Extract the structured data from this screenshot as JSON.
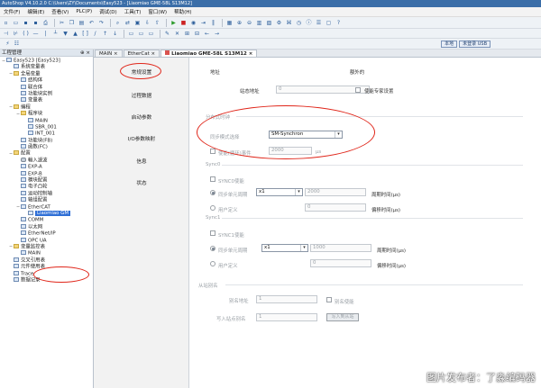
{
  "window": {
    "title": "AutoShop V4.10.2.0  C:\\Users\\ZY\\Documents\\Easy523 - [Liaomiao GME-58L S13M12]"
  },
  "menu": [
    "文件(F)",
    "编辑(E)",
    "查看(V)",
    "PLC(P)",
    "调试(D)",
    "工具(T)",
    "窗口(W)",
    "帮助(H)"
  ],
  "toolbar": {
    "local_label": "本地",
    "plc_status": "未登录 USB"
  },
  "left_panel": {
    "title": "工程管理",
    "pin": "⊕ ×",
    "tree": [
      {
        "label": "Easy523 [Easy523]",
        "indent": 0,
        "icon": "project-icon"
      },
      {
        "label": "系统变量表",
        "indent": 1,
        "icon": "table-icon"
      },
      {
        "label": "全局变量",
        "indent": 1,
        "icon": "folder-icon"
      },
      {
        "label": "结构体",
        "indent": 2,
        "icon": "struct-icon"
      },
      {
        "label": "联合体",
        "indent": 2,
        "icon": "union-icon"
      },
      {
        "label": "功能块实例",
        "indent": 2,
        "icon": "fb-icon"
      },
      {
        "label": "变量表",
        "indent": 2,
        "icon": "table-icon"
      },
      {
        "label": "编程",
        "indent": 1,
        "icon": "folder-icon"
      },
      {
        "label": "程序块",
        "indent": 2,
        "icon": "folder-icon"
      },
      {
        "label": "MAIN",
        "indent": 3,
        "icon": "program-icon"
      },
      {
        "label": "SBR_001",
        "indent": 3,
        "icon": "program-icon"
      },
      {
        "label": "INT_001",
        "indent": 3,
        "icon": "program-icon"
      },
      {
        "label": "功能块(FB)",
        "indent": 2,
        "icon": "fb-icon"
      },
      {
        "label": "函数(FC)",
        "indent": 2,
        "icon": "fc-icon"
      },
      {
        "label": "配置",
        "indent": 1,
        "icon": "folder-icon"
      },
      {
        "label": "輸入濾波",
        "indent": 2,
        "icon": "gear-icon"
      },
      {
        "label": "EXP-A",
        "indent": 2,
        "icon": "module-icon"
      },
      {
        "label": "EXP-B",
        "indent": 2,
        "icon": "module-icon"
      },
      {
        "label": "模块配置",
        "indent": 2,
        "icon": "module-icon"
      },
      {
        "label": "电子凸轮",
        "indent": 2,
        "icon": "cam-icon"
      },
      {
        "label": "运动控制轴",
        "indent": 2,
        "icon": "axis-icon"
      },
      {
        "label": "轴组配置",
        "indent": 2,
        "icon": "axis-icon"
      },
      {
        "label": "EtherCAT",
        "indent": 2,
        "icon": "network-icon"
      },
      {
        "label": "Liaomiao GM",
        "indent": 3,
        "icon": "device-icon",
        "selected": true
      },
      {
        "label": "COMM",
        "indent": 2,
        "icon": "comm-icon"
      },
      {
        "label": "以太网",
        "indent": 2,
        "icon": "network-icon"
      },
      {
        "label": "EtherNet/IP",
        "indent": 2,
        "icon": "network-icon"
      },
      {
        "label": "OPC UA",
        "indent": 2,
        "icon": "network-icon"
      },
      {
        "label": "变量监控表",
        "indent": 1,
        "icon": "folder-icon"
      },
      {
        "label": "MAIN",
        "indent": 2,
        "icon": "table-icon"
      },
      {
        "label": "交叉引用表",
        "indent": 1,
        "icon": "table-icon"
      },
      {
        "label": "元件使用表",
        "indent": 1,
        "icon": "table-icon"
      },
      {
        "label": "Trace",
        "indent": 1,
        "icon": "trace-icon"
      },
      {
        "label": "数据记录",
        "indent": 1,
        "icon": "record-icon"
      }
    ]
  },
  "tabs": [
    {
      "label": "MAIN",
      "active": false
    },
    {
      "label": "EtherCat",
      "active": false
    },
    {
      "label": "Liaomiao GME-58L S13M12",
      "active": true
    }
  ],
  "tab_close": "×",
  "config_nav": [
    "常规设置",
    "过程数据",
    "启动参数",
    "I/O参数映射",
    "信息",
    "状态"
  ],
  "general": {
    "address_heading": "地址",
    "extra_heading": "额外的",
    "station_alias_label": "站态地址",
    "station_alias_value": "0",
    "use_expert_label": "使能专家设置",
    "distributed_clock": "分布式时钟",
    "sync_mode_label": "同步模式选择",
    "sync_mode_value": "SM-Synchron",
    "sync_unit_label": "使能(循环)事件",
    "sync_unit_value": "2000",
    "sync_unit_unit": "μs",
    "sync0": {
      "header": "Sync0",
      "enable_label": "SYNC0使能",
      "sync_unit_cycle_label": "同步单元周期",
      "multiplier": "x1",
      "cycle_value": "2000",
      "cycle_time_label": "周期时间(μs)",
      "user_defined_label": "用户定义",
      "user_value": "0",
      "offset_label": "偏移时间(μs)"
    },
    "sync1": {
      "header": "Sync1",
      "enable_label": "SYNC1使能",
      "sync_unit_cycle_label": "同步单元周期",
      "multiplier": "x1",
      "cycle_value": "1000",
      "cycle_time_label": "周期时间(μs)",
      "user_defined_label": "用户定义",
      "user_value": "0",
      "offset_label": "偏移时间(μs)"
    },
    "slave_alias": {
      "header": "从站别名",
      "alias_label": "别名地址",
      "alias_value": "1",
      "enable_alias_label": "别名使能",
      "write_alias_label": "写入站点别名",
      "write_alias_value": "1",
      "write_button": "写入到从站"
    }
  },
  "watermark": "图片发布者：了淼编码器",
  "colors": {
    "annotation": "#e0261a",
    "selection": "#2f6fd6",
    "titlebar": "#3b6ea8"
  }
}
